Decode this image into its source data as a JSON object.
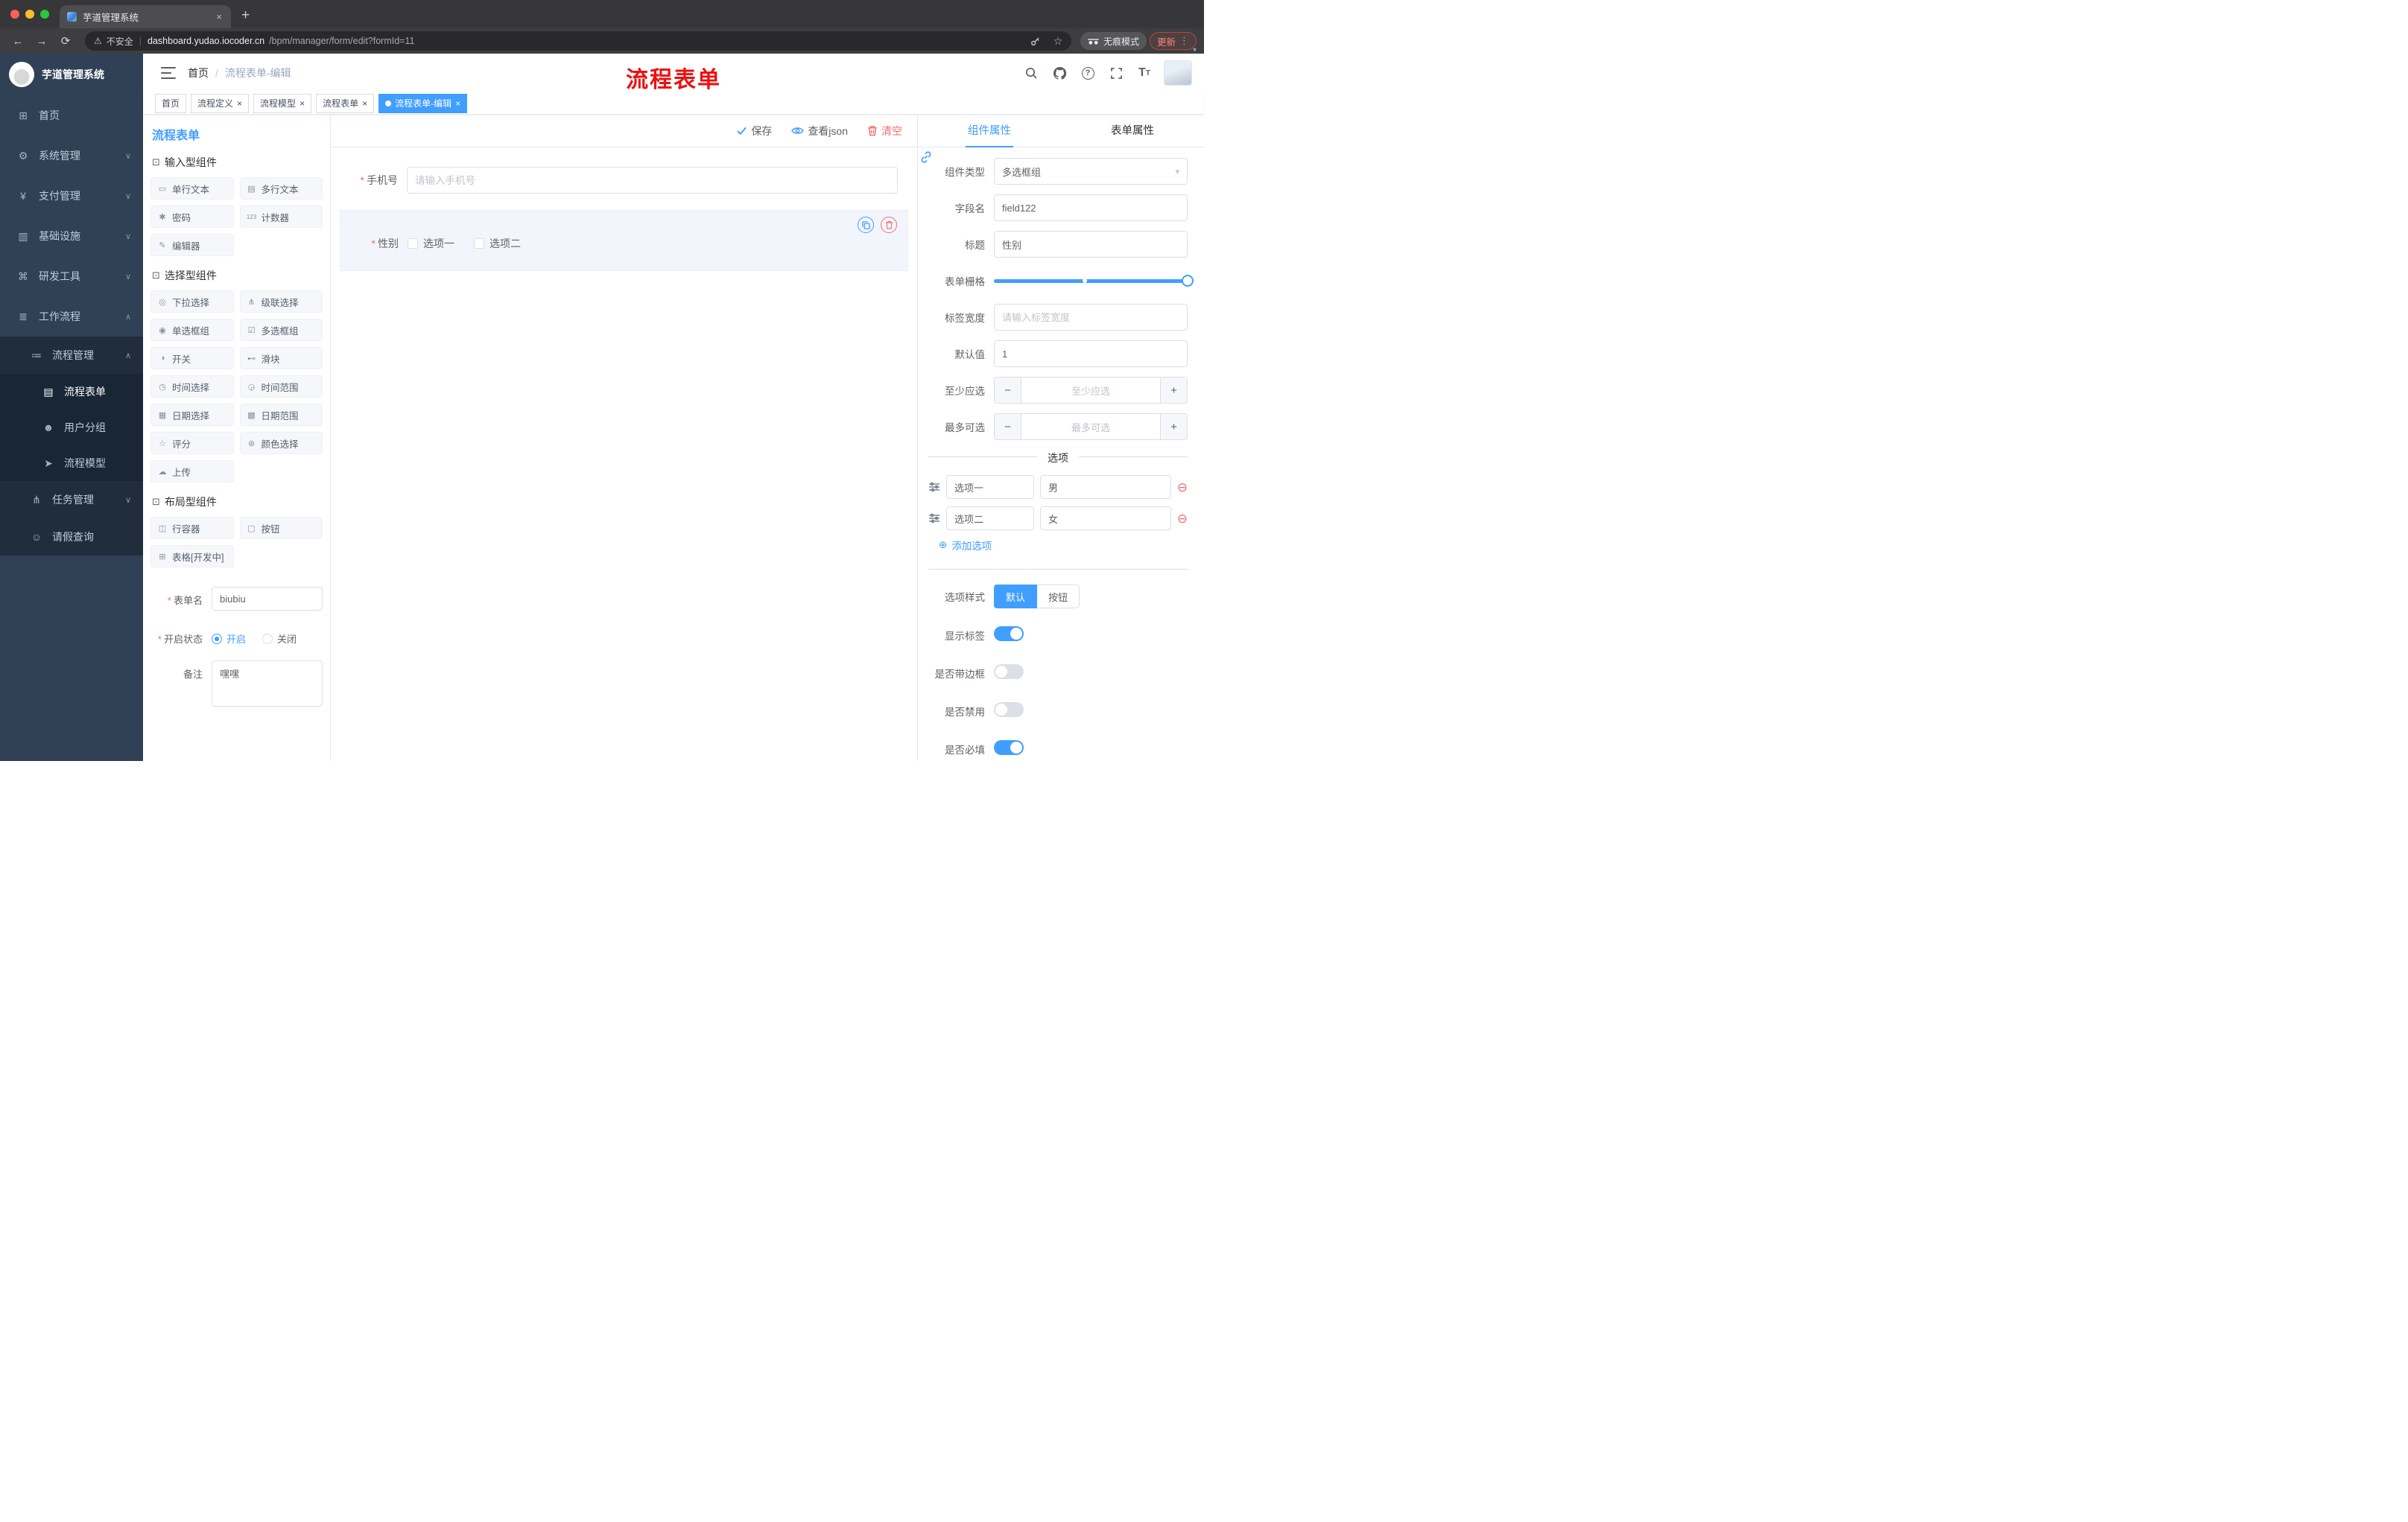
{
  "browser": {
    "tab_title": "芋道管理系统",
    "security_label": "不安全",
    "url_domain": "dashboard.yudao.iocoder.cn",
    "url_path": "/bpm/manager/form/edit?formId=11",
    "incognito_label": "无痕模式",
    "update_label": "更新"
  },
  "icons": {
    "close": "×",
    "new_tab": "+",
    "back": "←",
    "forward": "→",
    "reload": "⟳",
    "star": "☆",
    "warning": "⚠",
    "pipe": "|",
    "kebab": "⋮",
    "caret": "▾",
    "chevron_down": "∨",
    "chevron_up": "∧",
    "select_chevron": "▾",
    "minus": "−",
    "plus": "+",
    "minus_circle": "⊖",
    "plus_circle": "⊕",
    "required": "*",
    "crumb_sep": "/",
    "group": "⊡",
    "question": "?",
    "text_size": "T"
  },
  "sidebar": {
    "logo_title": "芋道管理系统",
    "items": [
      {
        "label": "首页",
        "icon": "⊞"
      },
      {
        "label": "系统管理",
        "icon": "⚙"
      },
      {
        "label": "支付管理",
        "icon": "¥"
      },
      {
        "label": "基础设施",
        "icon": "▥"
      },
      {
        "label": "研发工具",
        "icon": "⌘"
      },
      {
        "label": "工作流程",
        "icon": "≣"
      },
      {
        "label": "流程管理",
        "icon": "≔"
      },
      {
        "label": "流程表单",
        "icon": "▤"
      },
      {
        "label": "用户分组",
        "icon": "☻"
      },
      {
        "label": "流程模型",
        "icon": "➤"
      },
      {
        "label": "任务管理",
        "icon": "⋔"
      },
      {
        "label": "请假查询",
        "icon": "☺"
      }
    ]
  },
  "header": {
    "breadcrumb": [
      "首页",
      "流程表单-编辑"
    ],
    "annotation": "流程表单"
  },
  "tags": [
    {
      "label": "首页"
    },
    {
      "label": "流程定义"
    },
    {
      "label": "流程模型"
    },
    {
      "label": "流程表单"
    },
    {
      "label": "流程表单-编辑"
    }
  ],
  "palette": {
    "title": "流程表单",
    "groups": [
      {
        "title": "输入型组件",
        "items": [
          {
            "label": "单行文本",
            "icon": "▭"
          },
          {
            "label": "多行文本",
            "icon": "▤"
          },
          {
            "label": "密码",
            "icon": "✱"
          },
          {
            "label": "计数器",
            "icon": "123"
          },
          {
            "label": "编辑器",
            "icon": "✎"
          }
        ]
      },
      {
        "title": "选择型组件",
        "items": [
          {
            "label": "下拉选择",
            "icon": "◎"
          },
          {
            "label": "级联选择",
            "icon": "⋔"
          },
          {
            "label": "单选框组",
            "icon": "◉"
          },
          {
            "label": "多选框组",
            "icon": "☑"
          },
          {
            "label": "开关",
            "icon": "◑"
          },
          {
            "label": "滑块",
            "icon": "⊷"
          },
          {
            "label": "时间选择",
            "icon": "◷"
          },
          {
            "label": "时间范围",
            "icon": "◶"
          },
          {
            "label": "日期选择",
            "icon": "▦"
          },
          {
            "label": "日期范围",
            "icon": "▩"
          },
          {
            "label": "评分",
            "icon": "☆"
          },
          {
            "label": "颜色选择",
            "icon": "⊛"
          },
          {
            "label": "上传",
            "icon": "☁"
          }
        ]
      },
      {
        "title": "布局型组件",
        "items": [
          {
            "label": "行容器",
            "icon": "◫"
          },
          {
            "label": "按钮",
            "icon": "▢"
          },
          {
            "label": "表格[开发中]",
            "icon": "⊞"
          }
        ]
      }
    ],
    "form": {
      "name_label": "表单名",
      "name_value": "biubiu",
      "status_label": "开启状态",
      "status_on": "开启",
      "status_off": "关闭",
      "remark_label": "备注",
      "remark_value": "嘿嘿"
    }
  },
  "canvas": {
    "toolbar": {
      "save": "保存",
      "view_json": "查看json",
      "clear": "清空"
    },
    "phone_field": {
      "label": "手机号",
      "placeholder": "请输入手机号"
    },
    "gender_field": {
      "label": "性别",
      "option1": "选项一",
      "option2": "选项二"
    }
  },
  "props": {
    "tabs": {
      "component": "组件属性",
      "form": "表单属性"
    },
    "component_type": {
      "label": "组件类型",
      "value": "多选框组"
    },
    "field_name": {
      "label": "字段名",
      "value": "field122"
    },
    "title": {
      "label": "标题",
      "value": "性别"
    },
    "grid": {
      "label": "表单栅格"
    },
    "label_width": {
      "label": "标签宽度",
      "placeholder": "请输入标签宽度"
    },
    "default_value": {
      "label": "默认值",
      "value": "1"
    },
    "min_select": {
      "label": "至少应选",
      "placeholder": "至少应选"
    },
    "max_select": {
      "label": "最多可选",
      "placeholder": "最多可选"
    },
    "options": {
      "title": "选项",
      "rows": [
        {
          "name": "选项一",
          "value": "男"
        },
        {
          "name": "选项二",
          "value": "女"
        }
      ],
      "add": "添加选项"
    },
    "option_style": {
      "label": "选项样式",
      "default": "默认",
      "button": "按钮"
    },
    "toggles": [
      {
        "label": "显示标签",
        "on": true
      },
      {
        "label": "是否带边框",
        "on": false
      },
      {
        "label": "是否禁用",
        "on": false
      },
      {
        "label": "是否必填",
        "on": true
      }
    ]
  },
  "colors": {
    "primary": "#409eff",
    "danger": "#f56c6c",
    "sidebar": "#304156"
  }
}
